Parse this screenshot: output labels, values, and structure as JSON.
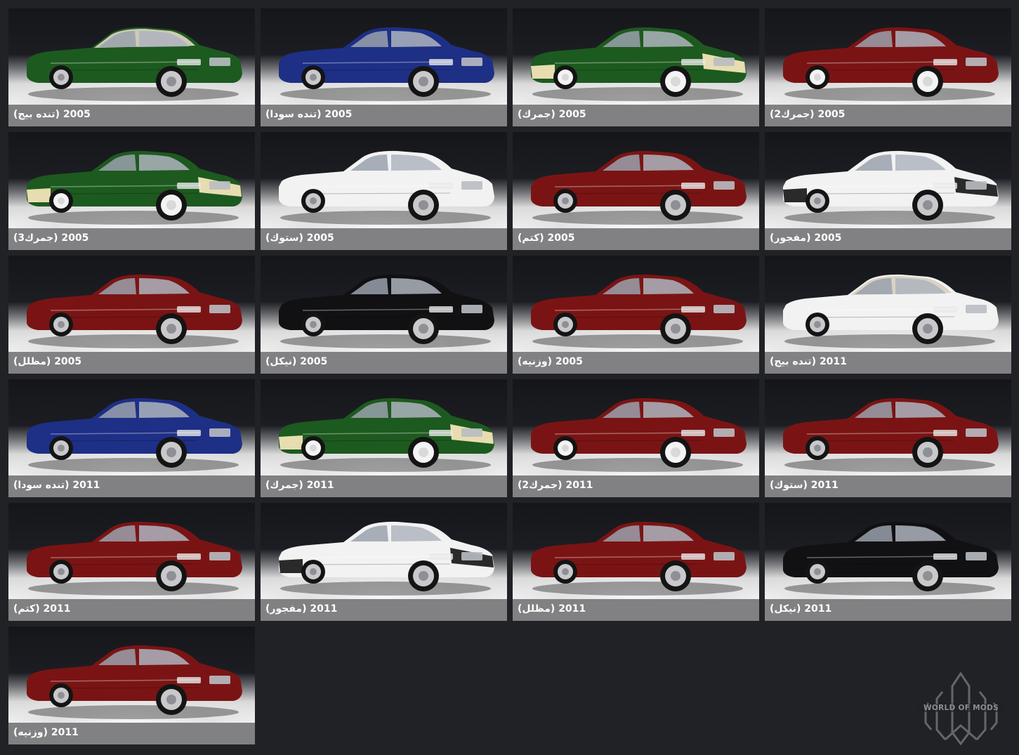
{
  "gallery": {
    "tiles": [
      {
        "caption": "2005 (تنده بيج)",
        "body_color": "#1d5a1f",
        "roof_color": "#d8d1c0",
        "accent_color": "#1d5a1f",
        "wheel_style": "chrome"
      },
      {
        "caption": "2005 (تنده سودا)",
        "body_color": "#1e2f86",
        "roof_color": "#1e2f86",
        "accent_color": "#1e2f86",
        "wheel_style": "chrome"
      },
      {
        "caption": "2005 (جمرك)",
        "body_color": "#1d5a1f",
        "roof_color": "#1d5a1f",
        "accent_color": "#e8ddb0",
        "wheel_style": "white"
      },
      {
        "caption": "2005 (جمرك2)",
        "body_color": "#7a1414",
        "roof_color": "#7a1414",
        "accent_color": "#7a1414",
        "wheel_style": "white"
      },
      {
        "caption": "2005 (جمرك3)",
        "body_color": "#1d5a1f",
        "roof_color": "#1d5a1f",
        "accent_color": "#e8ddb0",
        "wheel_style": "white"
      },
      {
        "caption": "2005 (ستوك)",
        "body_color": "#f2f2f2",
        "roof_color": "#f2f2f2",
        "accent_color": "#f2f2f2",
        "wheel_style": "chrome"
      },
      {
        "caption": "2005 (كتم)",
        "body_color": "#7a1414",
        "roof_color": "#7a1414",
        "accent_color": "#7a1414",
        "wheel_style": "chrome"
      },
      {
        "caption": "2005 (مفجور)",
        "body_color": "#f2f2f2",
        "roof_color": "#f2f2f2",
        "accent_color": "#2a2a2a",
        "wheel_style": "chrome"
      },
      {
        "caption": "2005 (مظلل)",
        "body_color": "#7a1414",
        "roof_color": "#7a1414",
        "accent_color": "#7a1414",
        "wheel_style": "chrome"
      },
      {
        "caption": "2005 (نيكل)",
        "body_color": "#111113",
        "roof_color": "#111113",
        "accent_color": "#111113",
        "wheel_style": "chrome"
      },
      {
        "caption": "2005 (وزنيه)",
        "body_color": "#7a1414",
        "roof_color": "#7a1414",
        "accent_color": "#7a1414",
        "wheel_style": "chrome"
      },
      {
        "caption": "2011 (تنده بيج)",
        "body_color": "#f2f2f2",
        "roof_color": "#d8d1c0",
        "accent_color": "#f2f2f2",
        "wheel_style": "chrome"
      },
      {
        "caption": "2011 (تنده سودا)",
        "body_color": "#1e2f86",
        "roof_color": "#1e2f86",
        "accent_color": "#1e2f86",
        "wheel_style": "chrome"
      },
      {
        "caption": "2011 (جمرك)",
        "body_color": "#1d5a1f",
        "roof_color": "#1d5a1f",
        "accent_color": "#e8ddb0",
        "wheel_style": "white"
      },
      {
        "caption": "2011 (جمرك2)",
        "body_color": "#7a1414",
        "roof_color": "#7a1414",
        "accent_color": "#7a1414",
        "wheel_style": "white"
      },
      {
        "caption": "2011 (ستوك)",
        "body_color": "#7a1414",
        "roof_color": "#7a1414",
        "accent_color": "#7a1414",
        "wheel_style": "chrome"
      },
      {
        "caption": "2011 (كتم)",
        "body_color": "#7a1414",
        "roof_color": "#7a1414",
        "accent_color": "#7a1414",
        "wheel_style": "chrome"
      },
      {
        "caption": "2011 (مفجور)",
        "body_color": "#f2f2f2",
        "roof_color": "#f2f2f2",
        "accent_color": "#2a2a2a",
        "wheel_style": "chrome"
      },
      {
        "caption": "2011 (مظلل)",
        "body_color": "#7a1414",
        "roof_color": "#7a1414",
        "accent_color": "#7a1414",
        "wheel_style": "chrome"
      },
      {
        "caption": "2011 (نيكل)",
        "body_color": "#111113",
        "roof_color": "#111113",
        "accent_color": "#111113",
        "wheel_style": "chrome"
      },
      {
        "caption": "2011 (وزنيه)",
        "body_color": "#7a1414",
        "roof_color": "#7a1414",
        "accent_color": "#7a1414",
        "wheel_style": "chrome"
      }
    ]
  },
  "watermark": {
    "text": "WORLD OF MODS",
    "icon": "world-of-mods-logo-icon"
  },
  "colors": {
    "page_background": "#202226",
    "caption_bar": "#818184",
    "caption_text": "#ffffff"
  }
}
